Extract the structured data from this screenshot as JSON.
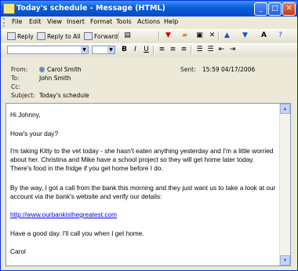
{
  "window": {
    "title": "Today's schedule - Message (HTML)"
  },
  "title_buttons": {
    "minimize": "_",
    "maximize": "□",
    "close": "✕"
  },
  "menu": [
    "File",
    "Edit",
    "View",
    "Insert",
    "Format",
    "Tools",
    "Actions",
    "Help"
  ],
  "toolbar": {
    "reply": "Reply",
    "reply_all": "Reply to All",
    "forward": "Forward"
  },
  "header": {
    "from_label": "From:",
    "from_value": "Carol Smith",
    "to_label": "To:",
    "to_value": "John Smith",
    "cc_label": "Cc:",
    "cc_value": "",
    "subject_label": "Subject:",
    "subject_value": "Today's schedule",
    "sent_label": "Sent:",
    "sent_value": "15:59 04/17/2006"
  },
  "message": {
    "greeting": "Hi Johnny,",
    "line1": "How's your day?",
    "para1": "I'm taking Kitty to the vet today - she hasn't eaten anything yesterday and I'm a little worried about her. Christina and Mike have a school project so they will get home later today. There's food in the fridge if you get home before I do.",
    "para2": "By the way, I got a call from the bank this morning and they just want us to take a look at our account via the bank's website and verify our details:",
    "link": "http://www.ourbankisthegreatest.com",
    "para3": "Have a good day. I'll call you when I get home.",
    "signature": "Carol"
  },
  "icons": [
    "envelope-icon",
    "minimize-icon",
    "maximize-icon",
    "close-icon",
    "reply-icon",
    "reply-all-icon",
    "forward-icon",
    "print-icon",
    "flag-icon",
    "folder-icon",
    "delete-icon",
    "up-icon",
    "down-icon",
    "font-icon",
    "help-icon",
    "bold-icon",
    "italic-icon",
    "underline-icon",
    "align-left-icon",
    "align-center-icon",
    "align-right-icon",
    "bullets-icon",
    "numbering-icon",
    "indent-icon",
    "outdent-icon",
    "contact-icon",
    "scroll-up-icon",
    "scroll-down-icon"
  ]
}
